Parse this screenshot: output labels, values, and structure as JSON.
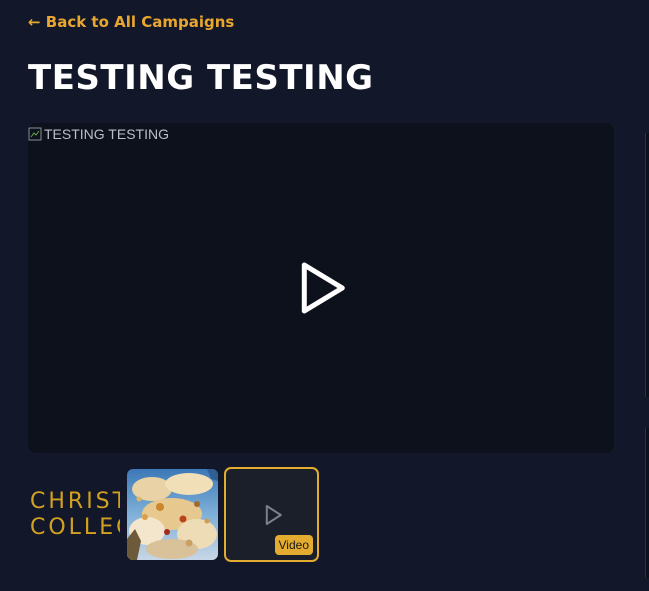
{
  "nav": {
    "back_label": "← Back to All Campaigns"
  },
  "campaign": {
    "title": "TESTING TESTING"
  },
  "player": {
    "image_alt": "TESTING TESTING",
    "play_icon": "play-icon"
  },
  "thumbnails": {
    "logo_line1": "CHRIST",
    "logo_line2": "COLLEC",
    "video_badge": "Video"
  },
  "colors": {
    "background": "#121829",
    "accent": "#e8a630",
    "player_bg": "#0d111b",
    "logo_gold": "#d3a120"
  }
}
